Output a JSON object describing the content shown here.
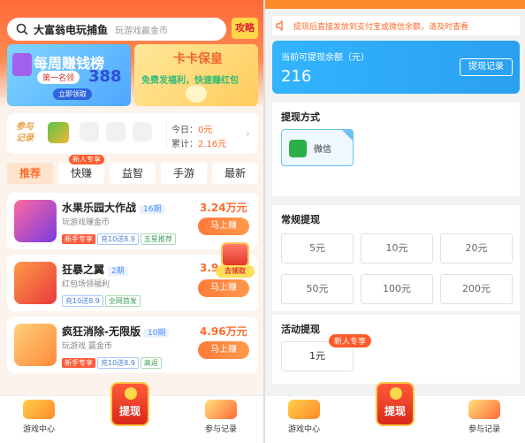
{
  "left": {
    "search": {
      "query": "大富翁电玩捕鱼",
      "placeholder": "玩游戏赢金币"
    },
    "guide_label": "攻略",
    "banner_weekly": {
      "title": "每周赚钱榜",
      "rank_label": "第一名领",
      "amount": "388",
      "cta": "立即领取"
    },
    "banner_kaka": {
      "title": "卡卡保皇",
      "subtitle": "免费发福利，快速赚红包"
    },
    "record": {
      "label": "参与记录",
      "today_label": "今日：",
      "today_value": "0元",
      "total_label": "累计：",
      "total_value": "2.16元"
    },
    "tabs": [
      {
        "label": "推荐",
        "active": true
      },
      {
        "label": "快赚",
        "badge": "新人专享"
      },
      {
        "label": "益智"
      },
      {
        "label": "手游"
      },
      {
        "label": "最新"
      }
    ],
    "games": [
      {
        "name": "水果乐园大作战",
        "period": "16期",
        "desc": "玩游戏赚金币",
        "tags": [
          {
            "text": "新手专享",
            "style": "red"
          },
          {
            "text": "充10送8.9",
            "style": "blue"
          },
          {
            "text": "五星推荐",
            "style": "green"
          }
        ],
        "amount": "3.24万元",
        "cta": "马上赚"
      },
      {
        "name": "狂暴之翼",
        "period": "2期",
        "desc": "红包场领福利",
        "tags": [
          {
            "text": "充10送8.9",
            "style": "blue"
          },
          {
            "text": "全网首发",
            "style": "green"
          }
        ],
        "amount": "3.9",
        "cta": "马上赚"
      },
      {
        "name": "疯狂消除-无限版",
        "period": "10期",
        "desc": "玩游戏 赢金币",
        "tags": [
          {
            "text": "新手专享",
            "style": "red"
          },
          {
            "text": "充10送8.9",
            "style": "blue"
          },
          {
            "text": "高返",
            "style": "green"
          }
        ],
        "amount": "4.96万元",
        "cta": "马上赚"
      }
    ],
    "gift_label": "去领取",
    "nav": {
      "games": "游戏中心",
      "withdraw": "提现",
      "records": "参与记录"
    }
  },
  "right": {
    "marquee": "提现后直接发放到支付宝或微信余额，请及时查看",
    "balance": {
      "label": "当前可提现余额（元）",
      "value": "216",
      "history": "提现记录"
    },
    "method": {
      "title": "提现方式",
      "option": "微信"
    },
    "regular": {
      "title": "常规提现",
      "amounts": [
        "5元",
        "10元",
        "20元",
        "50元",
        "100元",
        "200元"
      ]
    },
    "activity": {
      "title": "活动提现",
      "amount": "1元",
      "badge": "新人专享"
    },
    "nav": {
      "games": "游戏中心",
      "withdraw": "提现",
      "records": "参与记录"
    }
  },
  "colors": {
    "accent": "#ff6a2a",
    "blue": "#2aa0f0",
    "wechat": "#2ab048"
  }
}
